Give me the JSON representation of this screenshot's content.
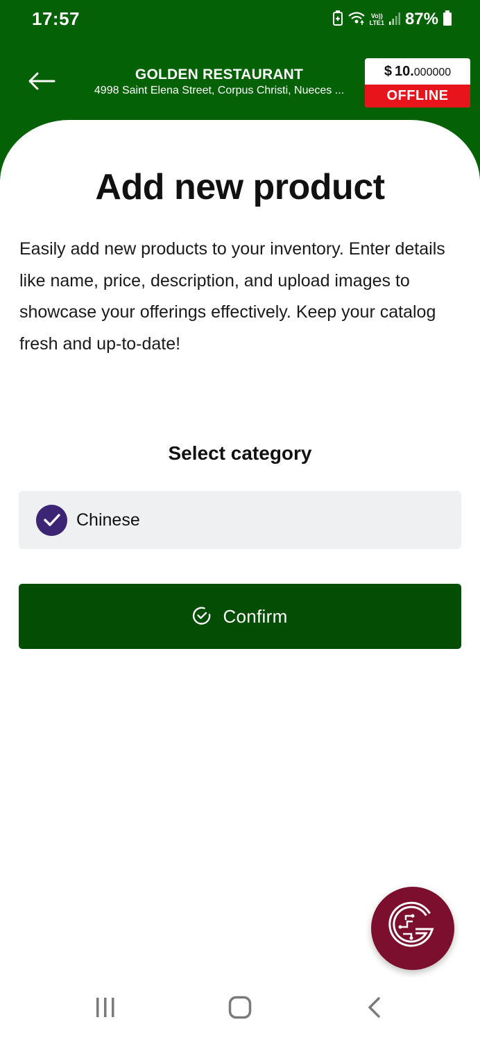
{
  "status_bar": {
    "time": "17:57",
    "network_label_top": "Vo))",
    "network_label_bottom": "LTE1",
    "battery_percent": "87%",
    "icons": [
      "battery-saver-icon",
      "wifi-icon",
      "signal-icon",
      "battery-icon"
    ]
  },
  "app_bar": {
    "back_icon": "back-arrow-icon",
    "restaurant_name": "GOLDEN RESTAURANT",
    "restaurant_address": "4998 Saint Elena Street, Corpus Christi, Nueces ...",
    "balance": {
      "currency": "$",
      "whole": "10.",
      "fraction": "000000"
    },
    "status": "OFFLINE"
  },
  "main": {
    "title": "Add new product",
    "description": "Easily add new products to your inventory. Enter details like name, price, description, and upload images to showcase your offerings effectively. Keep your catalog fresh and up-to-date!",
    "section_label": "Select category",
    "category": {
      "label": "Chinese",
      "selected": true
    },
    "confirm_label": "Confirm"
  },
  "fab": {
    "icon": "brand-g-logo-icon"
  },
  "nav_bar": {
    "icons": [
      "recent-apps-icon",
      "home-icon",
      "back-icon"
    ]
  },
  "colors": {
    "header_green": "#056105",
    "button_green": "#044d04",
    "offline_red": "#e8141b",
    "check_purple": "#3d2575",
    "fab_maroon": "#7c0f2d"
  }
}
